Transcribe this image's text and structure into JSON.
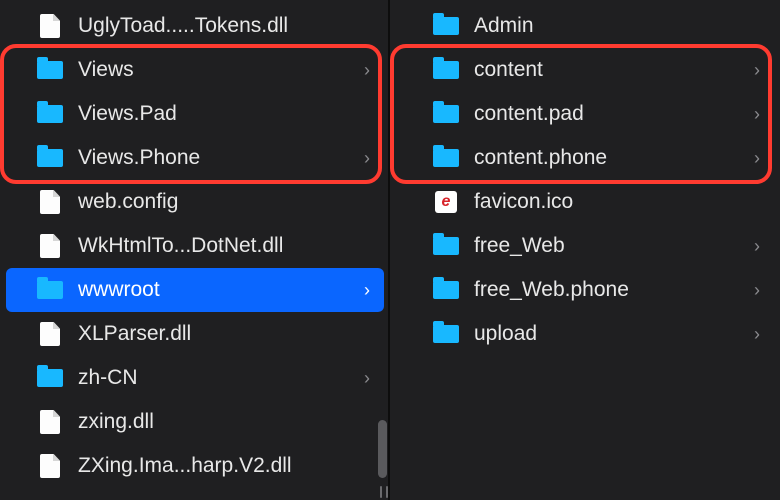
{
  "colors": {
    "accent": "#0a66ff",
    "folder": "#18b8ff",
    "highlight": "#ff3b30",
    "background": "#1f1f21"
  },
  "left": {
    "items": [
      {
        "label": "UglyToad.....Tokens.dll",
        "kind": "file",
        "nav": false,
        "selected": false
      },
      {
        "label": "Views",
        "kind": "folder",
        "nav": true,
        "selected": false
      },
      {
        "label": "Views.Pad",
        "kind": "folder",
        "nav": false,
        "selected": false
      },
      {
        "label": "Views.Phone",
        "kind": "folder",
        "nav": true,
        "selected": false
      },
      {
        "label": "web.config",
        "kind": "file",
        "nav": false,
        "selected": false
      },
      {
        "label": "WkHtmlTo...DotNet.dll",
        "kind": "file",
        "nav": false,
        "selected": false
      },
      {
        "label": "wwwroot",
        "kind": "folder",
        "nav": true,
        "selected": true
      },
      {
        "label": "XLParser.dll",
        "kind": "file",
        "nav": false,
        "selected": false
      },
      {
        "label": "zh-CN",
        "kind": "folder",
        "nav": true,
        "selected": false
      },
      {
        "label": "zxing.dll",
        "kind": "file",
        "nav": false,
        "selected": false
      },
      {
        "label": "ZXing.Ima...harp.V2.dll",
        "kind": "file",
        "nav": false,
        "selected": false
      }
    ],
    "highlight_range": [
      1,
      3
    ]
  },
  "right": {
    "items": [
      {
        "label": "Admin",
        "kind": "folder",
        "nav": false,
        "selected": false
      },
      {
        "label": "content",
        "kind": "folder",
        "nav": true,
        "selected": false
      },
      {
        "label": "content.pad",
        "kind": "folder",
        "nav": true,
        "selected": false
      },
      {
        "label": "content.phone",
        "kind": "folder",
        "nav": true,
        "selected": false
      },
      {
        "label": "favicon.ico",
        "kind": "favicon",
        "nav": false,
        "selected": false
      },
      {
        "label": "free_Web",
        "kind": "folder",
        "nav": true,
        "selected": false
      },
      {
        "label": "free_Web.phone",
        "kind": "folder",
        "nav": true,
        "selected": false
      },
      {
        "label": "upload",
        "kind": "folder",
        "nav": true,
        "selected": false
      }
    ],
    "highlight_range": [
      1,
      3
    ]
  }
}
